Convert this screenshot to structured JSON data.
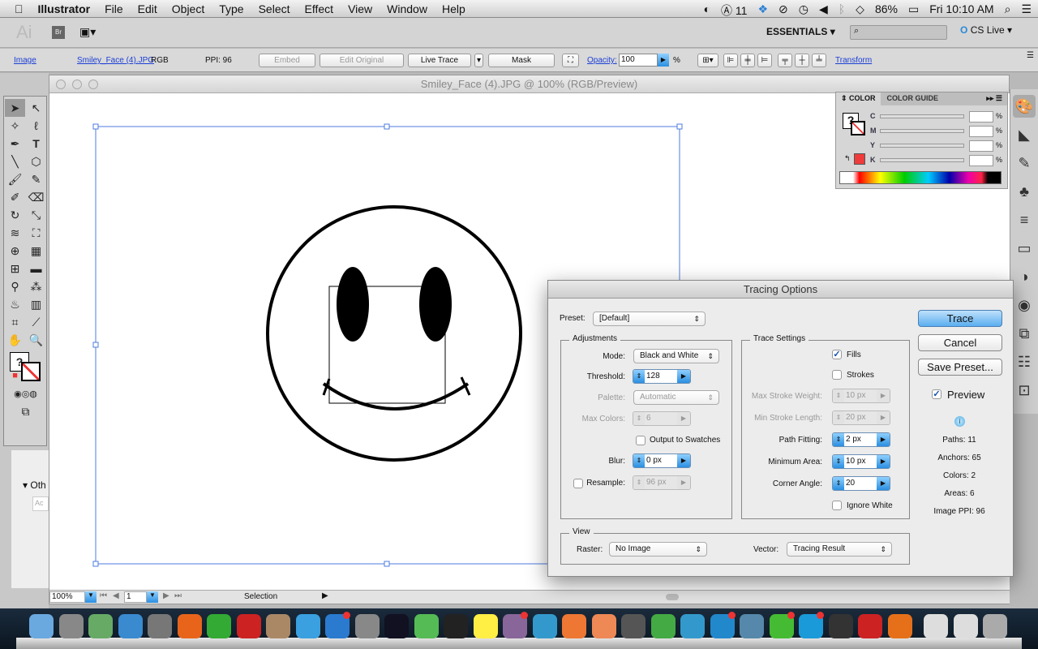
{
  "menubar": {
    "app": "Illustrator",
    "items": [
      "File",
      "Edit",
      "Object",
      "Type",
      "Select",
      "Effect",
      "View",
      "Window",
      "Help"
    ],
    "status": {
      "adobe_count": "11",
      "battery": "86%",
      "clock": "Fri 10:10 AM"
    }
  },
  "appbar": {
    "logo": "Ai",
    "bridge": "Br",
    "workspace": "ESSENTIALS",
    "search_placeholder": "",
    "cs_live": "CS Live"
  },
  "control": {
    "type": "Image",
    "file": "Smiley_Face (4).JPG",
    "mode": "RGB",
    "ppi": "PPI: 96",
    "embed": "Embed",
    "edit_original": "Edit Original",
    "live_trace": "Live Trace",
    "mask": "Mask",
    "opacity_label": "Opacity:",
    "opacity": "100",
    "pct": "%",
    "transform": "Transform"
  },
  "document": {
    "title": "Smiley_Face (4).JPG @ 100% (RGB/Preview)",
    "zoom": "100%",
    "artboard": "1",
    "status_tool": "Selection"
  },
  "left_panel_fragment": {
    "section": "Oth",
    "input": "Ac"
  },
  "color_panel": {
    "tabs": [
      "COLOR",
      "COLOR GUIDE"
    ],
    "channels": [
      {
        "label": "C",
        "value": ""
      },
      {
        "label": "M",
        "value": ""
      },
      {
        "label": "Y",
        "value": ""
      },
      {
        "label": "K",
        "value": ""
      }
    ],
    "pct": "%",
    "fill_color": "#ef3b3b"
  },
  "dialog": {
    "title": "Tracing Options",
    "preset_label": "Preset:",
    "preset": "[Default]",
    "adjustments": {
      "title": "Adjustments",
      "mode_label": "Mode:",
      "mode": "Black and White",
      "threshold_label": "Threshold:",
      "threshold": "128",
      "palette_label": "Palette:",
      "palette": "Automatic",
      "max_colors_label": "Max Colors:",
      "max_colors": "6",
      "output_swatches": "Output to Swatches",
      "output_swatches_checked": false,
      "blur_label": "Blur:",
      "blur": "0 px",
      "resample_label": "Resample:",
      "resample": "96 px",
      "resample_checked": false
    },
    "trace_settings": {
      "title": "Trace Settings",
      "fills": "Fills",
      "fills_checked": true,
      "strokes": "Strokes",
      "strokes_checked": false,
      "max_stroke_weight_label": "Max Stroke Weight:",
      "max_stroke_weight": "10 px",
      "min_stroke_length_label": "Min Stroke Length:",
      "min_stroke_length": "20 px",
      "path_fitting_label": "Path Fitting:",
      "path_fitting": "2 px",
      "minimum_area_label": "Minimum Area:",
      "minimum_area": "10 px",
      "corner_angle_label": "Corner Angle:",
      "corner_angle": "20",
      "ignore_white": "Ignore White",
      "ignore_white_checked": false
    },
    "view": {
      "title": "View",
      "raster_label": "Raster:",
      "raster": "No Image",
      "vector_label": "Vector:",
      "vector": "Tracing Result"
    },
    "buttons": {
      "trace": "Trace",
      "cancel": "Cancel",
      "save_preset": "Save Preset..."
    },
    "preview": "Preview",
    "preview_checked": true,
    "stats": [
      "Paths: 11",
      "Anchors: 65",
      "Colors: 2",
      "Areas: 6",
      "Image PPI: 96"
    ]
  },
  "dock": {
    "badge_color": "#e33"
  }
}
